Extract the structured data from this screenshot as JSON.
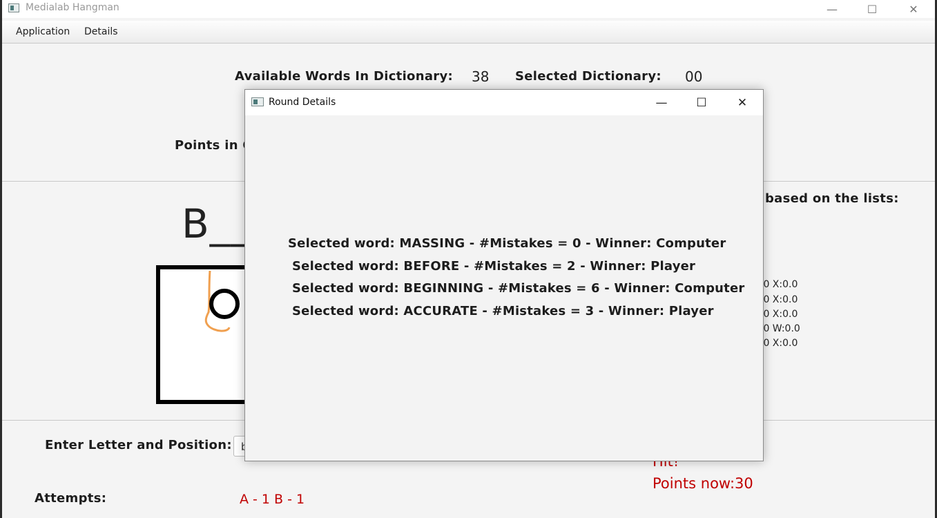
{
  "window": {
    "title": "Medialab Hangman",
    "controls": {
      "minimize": "—",
      "maximize": "☐",
      "close": "✕"
    }
  },
  "menu": {
    "items": [
      "Application",
      "Details"
    ]
  },
  "header": {
    "available_words_label": "Available Words In Dictionary:",
    "available_words_value": "38",
    "selected_dictionary_label": "Selected Dictionary:",
    "selected_dictionary_value": "00",
    "points_label_partial": "Points in C"
  },
  "word_display": "B___",
  "right_panel": {
    "title_partial": "based on the lists:",
    "lines": [
      ".0 X:0.0",
      ".0 X:0.0",
      ".0 X:0.0",
      ".0 W:0.0",
      ".0 X:0.0"
    ]
  },
  "input_section": {
    "label": "Enter Letter and Position:",
    "letter_value": "b",
    "attempts_label": "Attempts:",
    "attempts_value": "A - 1  B - 1",
    "status_hit": "Hit!",
    "status_points": "Points now:30"
  },
  "dialog": {
    "title": "Round Details",
    "controls": {
      "minimize": "—",
      "maximize": "☐",
      "close": "✕"
    },
    "rounds": [
      "Selected word: MASSING - #Mistakes = 0 - Winner: Computer",
      "Selected word: BEFORE - #Mistakes = 2 - Winner: Player",
      "Selected word: BEGINNING - #Mistakes = 6 - Winner: Computer",
      "Selected word: ACCURATE - #Mistakes = 3 - Winner: Player"
    ]
  },
  "colors": {
    "accent_red": "#c00000",
    "rope_orange": "#f0a050"
  }
}
